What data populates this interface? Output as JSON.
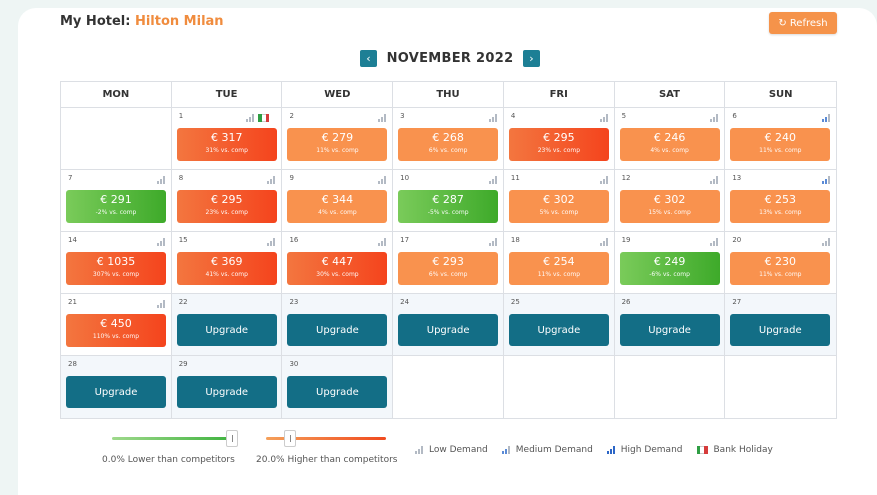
{
  "header": {
    "hotel_prefix": "My Hotel:",
    "hotel_name": "Hilton Milan",
    "refresh_label": "Refresh"
  },
  "calendar": {
    "month_label": "NOVEMBER 2022",
    "weekdays": [
      "MON",
      "TUE",
      "WED",
      "THU",
      "FRI",
      "SAT",
      "SUN"
    ],
    "upgrade_label": "Upgrade",
    "colors": {
      "red": "#f65a2e",
      "orange": "#f9924e",
      "green": "#5bbd3a",
      "upgrade": "#136e86"
    },
    "weeks": [
      [
        {
          "empty": true
        },
        {
          "day": "1",
          "price": "€ 317",
          "cmp": "31% vs. comp",
          "color": "red",
          "demand": "low",
          "holiday": true
        },
        {
          "day": "2",
          "price": "€ 279",
          "cmp": "11% vs. comp",
          "color": "orange",
          "demand": "low"
        },
        {
          "day": "3",
          "price": "€ 268",
          "cmp": "6% vs. comp",
          "color": "orange",
          "demand": "low"
        },
        {
          "day": "4",
          "price": "€ 295",
          "cmp": "23% vs. comp",
          "color": "red",
          "demand": "low"
        },
        {
          "day": "5",
          "price": "€ 246",
          "cmp": "4% vs. comp",
          "color": "orange",
          "demand": "low"
        },
        {
          "day": "6",
          "price": "€ 240",
          "cmp": "11% vs. comp",
          "color": "orange",
          "demand": "medium"
        }
      ],
      [
        {
          "day": "7",
          "price": "€ 291",
          "cmp": "-2% vs. comp",
          "color": "green",
          "demand": "low"
        },
        {
          "day": "8",
          "price": "€ 295",
          "cmp": "23% vs. comp",
          "color": "red",
          "demand": "low"
        },
        {
          "day": "9",
          "price": "€ 344",
          "cmp": "4% vs. comp",
          "color": "orange",
          "demand": "low"
        },
        {
          "day": "10",
          "price": "€ 287",
          "cmp": "-5% vs. comp",
          "color": "green",
          "demand": "low"
        },
        {
          "day": "11",
          "price": "€ 302",
          "cmp": "5% vs. comp",
          "color": "orange",
          "demand": "low"
        },
        {
          "day": "12",
          "price": "€ 302",
          "cmp": "15% vs. comp",
          "color": "orange",
          "demand": "low"
        },
        {
          "day": "13",
          "price": "€ 253",
          "cmp": "13% vs. comp",
          "color": "orange",
          "demand": "medium"
        }
      ],
      [
        {
          "day": "14",
          "price": "€ 1035",
          "cmp": "307% vs. comp",
          "color": "red",
          "demand": "low"
        },
        {
          "day": "15",
          "price": "€ 369",
          "cmp": "41% vs. comp",
          "color": "red",
          "demand": "low"
        },
        {
          "day": "16",
          "price": "€ 447",
          "cmp": "30% vs. comp",
          "color": "red",
          "demand": "low"
        },
        {
          "day": "17",
          "price": "€ 293",
          "cmp": "6% vs. comp",
          "color": "orange",
          "demand": "low"
        },
        {
          "day": "18",
          "price": "€ 254",
          "cmp": "11% vs. comp",
          "color": "orange",
          "demand": "low"
        },
        {
          "day": "19",
          "price": "€ 249",
          "cmp": "-6% vs. comp",
          "color": "green",
          "demand": "low"
        },
        {
          "day": "20",
          "price": "€ 230",
          "cmp": "11% vs. comp",
          "color": "orange",
          "demand": "low"
        }
      ],
      [
        {
          "day": "21",
          "price": "€ 450",
          "cmp": "110% vs. comp",
          "color": "red",
          "demand": "low"
        },
        {
          "day": "22",
          "upgrade": true
        },
        {
          "day": "23",
          "upgrade": true
        },
        {
          "day": "24",
          "upgrade": true
        },
        {
          "day": "25",
          "upgrade": true
        },
        {
          "day": "26",
          "upgrade": true
        },
        {
          "day": "27",
          "upgrade": true
        }
      ],
      [
        {
          "day": "28",
          "upgrade": true
        },
        {
          "day": "29",
          "upgrade": true
        },
        {
          "day": "30",
          "upgrade": true
        },
        {
          "empty": true
        },
        {
          "empty": true
        },
        {
          "empty": true
        },
        {
          "empty": true
        }
      ]
    ]
  },
  "legend": {
    "lower_caption": "0.0% Lower than competitors",
    "lower_slider_level": 1.0,
    "higher_caption": "20.0% Higher than competitors",
    "higher_slider_level": 0.2,
    "low_demand": "Low Demand",
    "medium_demand": "Medium Demand",
    "high_demand": "High Demand",
    "bank_holiday": "Bank Holiday"
  }
}
